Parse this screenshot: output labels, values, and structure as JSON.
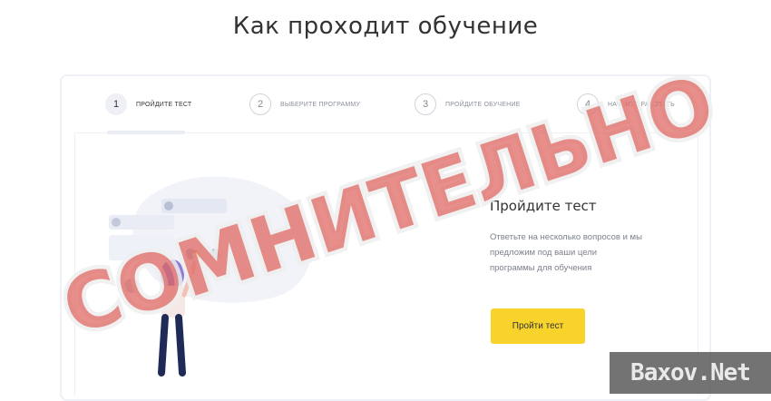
{
  "header": {
    "title": "Как проходит обучение"
  },
  "steps": [
    {
      "number": "1",
      "label": "Пройдите тест",
      "active": true
    },
    {
      "number": "2",
      "label": "Выберите программу",
      "active": false
    },
    {
      "number": "3",
      "label": "Пройдите обучение",
      "active": false
    },
    {
      "number": "4",
      "label": "Начните работать",
      "active": false
    }
  ],
  "panel": {
    "title": "Пройдите тест",
    "description": "Ответьте на несколько вопросов и мы предложим под ваши цели программы для обучения",
    "button_label": "Пройти тест"
  },
  "overlay": {
    "stamp_text": "СОМНИТЕЛЬНО",
    "watermark": "Baxov.Net"
  },
  "colors": {
    "accent_button": "#f7d32b",
    "stamp": "#e0645f"
  },
  "icons": [
    "woman-illustration",
    "floating-ui-cards"
  ]
}
